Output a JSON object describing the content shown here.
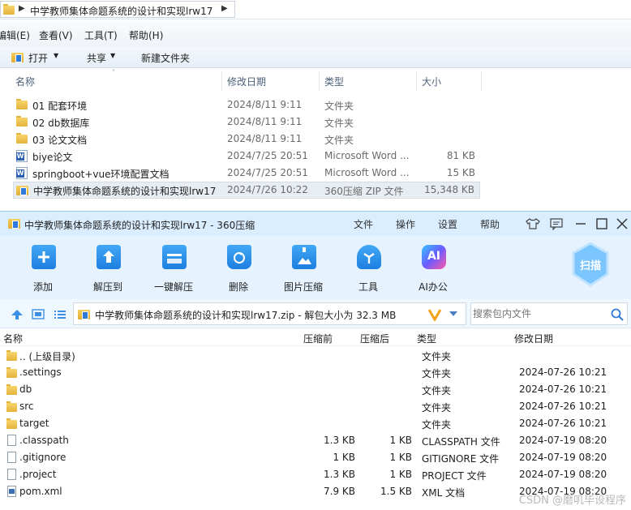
{
  "explorer": {
    "breadcrumb": "中学教师集体命题系统的设计和实现lrw17",
    "menu": [
      "编辑(E)",
      "查看(V)",
      "工具(T)",
      "帮助(H)"
    ],
    "toolbar": {
      "open": "打开",
      "share": "共享",
      "new_folder": "新建文件夹"
    },
    "columns": {
      "name": "名称",
      "date": "修改日期",
      "type": "类型",
      "size": "大小"
    },
    "rows": [
      {
        "name": "01 配套环境",
        "date": "2024/8/11 9:11",
        "type": "文件夹",
        "size": "",
        "icon": "folder-icon"
      },
      {
        "name": "02 db数据库",
        "date": "2024/8/11 9:11",
        "type": "文件夹",
        "size": "",
        "icon": "folder-icon"
      },
      {
        "name": "03 论文文档",
        "date": "2024/8/11 9:11",
        "type": "文件夹",
        "size": "",
        "icon": "folder-icon"
      },
      {
        "name": "biye论文",
        "date": "2024/7/25 20:51",
        "type": "Microsoft Word ...",
        "size": "81 KB",
        "icon": "word-icon"
      },
      {
        "name": "springboot+vue环境配置文档",
        "date": "2024/7/25 20:51",
        "type": "Microsoft Word ...",
        "size": "15 KB",
        "icon": "word-icon"
      },
      {
        "name": "中学教师集体命题系统的设计和实现lrw17",
        "date": "2024/7/26 10:22",
        "type": "360压缩 ZIP 文件",
        "size": "15,348 KB",
        "icon": "zip-icon"
      }
    ]
  },
  "zipwin": {
    "title": "中学教师集体命题系统的设计和实现lrw17 - 360压缩",
    "menu": [
      "文件",
      "操作",
      "设置",
      "帮助"
    ],
    "tools": [
      {
        "label": "添加",
        "icon": "add-icon"
      },
      {
        "label": "解压到",
        "icon": "extract-to-icon"
      },
      {
        "label": "一键解压",
        "icon": "one-click-extract-icon"
      },
      {
        "label": "删除",
        "icon": "delete-icon"
      },
      {
        "label": "图片压缩",
        "icon": "image-compress-icon"
      },
      {
        "label": "工具",
        "icon": "tools-icon"
      },
      {
        "label": "AI办公",
        "icon": "ai-office-icon"
      }
    ],
    "scan_label": "扫描",
    "ai_badge": "AI",
    "path": "中学教师集体命题系统的设计和实现lrw17.zip - 解包大小为 32.3 MB",
    "search_placeholder": "搜索包内文件",
    "columns": {
      "name": "名称",
      "compressed": "压缩前",
      "after": "压缩后",
      "type": "类型",
      "date": "修改日期"
    },
    "rows": [
      {
        "name": ".. (上级目录)",
        "before": "",
        "after": "",
        "type": "文件夹",
        "date": "",
        "icon": "folder-icon"
      },
      {
        "name": ".settings",
        "before": "",
        "after": "",
        "type": "文件夹",
        "date": "2024-07-26 10:21",
        "icon": "folder-icon"
      },
      {
        "name": "db",
        "before": "",
        "after": "",
        "type": "文件夹",
        "date": "2024-07-26 10:21",
        "icon": "folder-icon"
      },
      {
        "name": "src",
        "before": "",
        "after": "",
        "type": "文件夹",
        "date": "2024-07-26 10:21",
        "icon": "folder-icon"
      },
      {
        "name": "target",
        "before": "",
        "after": "",
        "type": "文件夹",
        "date": "2024-07-26 10:21",
        "icon": "folder-icon"
      },
      {
        "name": ".classpath",
        "before": "1.3 KB",
        "after": "1 KB",
        "type": "CLASSPATH 文件",
        "date": "2024-07-19 08:20",
        "icon": "file-icon"
      },
      {
        "name": ".gitignore",
        "before": "1 KB",
        "after": "1 KB",
        "type": "GITIGNORE 文件",
        "date": "2024-07-19 08:20",
        "icon": "file-icon"
      },
      {
        "name": ".project",
        "before": "1.3 KB",
        "after": "1 KB",
        "type": "PROJECT 文件",
        "date": "2024-07-19 08:20",
        "icon": "file-icon"
      },
      {
        "name": "pom.xml",
        "before": "7.9 KB",
        "after": "1.5 KB",
        "type": "XML 文档",
        "date": "2024-07-19 08:20",
        "icon": "xml-file-icon"
      }
    ]
  },
  "watermark": "CSDN @磨叽毕设程序"
}
